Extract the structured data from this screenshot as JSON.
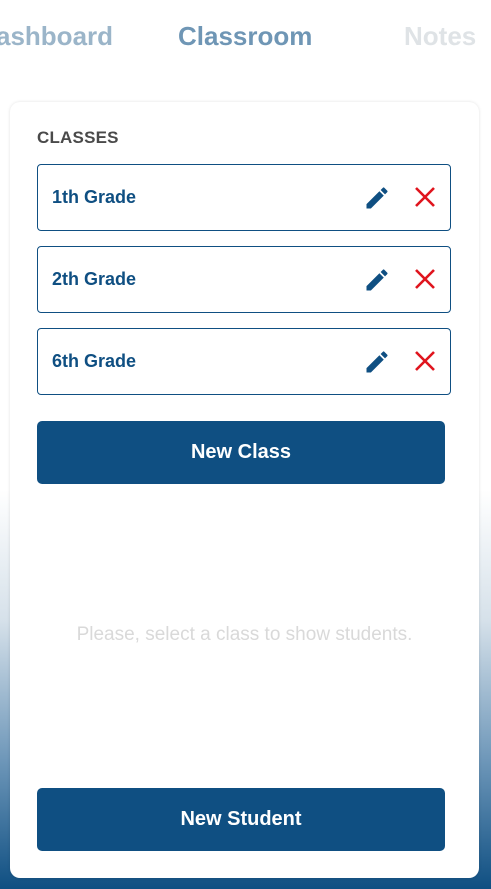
{
  "nav": {
    "tabs": [
      {
        "label": "ashboard"
      },
      {
        "label": "Classroom"
      },
      {
        "label": "Notes"
      }
    ],
    "active": "Classroom"
  },
  "classes": {
    "title": "CLASSES",
    "items": [
      {
        "label": "1th Grade"
      },
      {
        "label": "2th Grade"
      },
      {
        "label": "6th Grade"
      }
    ],
    "new_class_label": "New Class"
  },
  "students": {
    "empty_message": "Please, select a class to show students.",
    "new_student_label": "New Student"
  },
  "colors": {
    "primary": "#0f4f82",
    "danger": "#e0141e",
    "muted_text": "#d9d9d9"
  },
  "icons": {
    "edit": "pencil-icon",
    "delete": "close-icon"
  }
}
